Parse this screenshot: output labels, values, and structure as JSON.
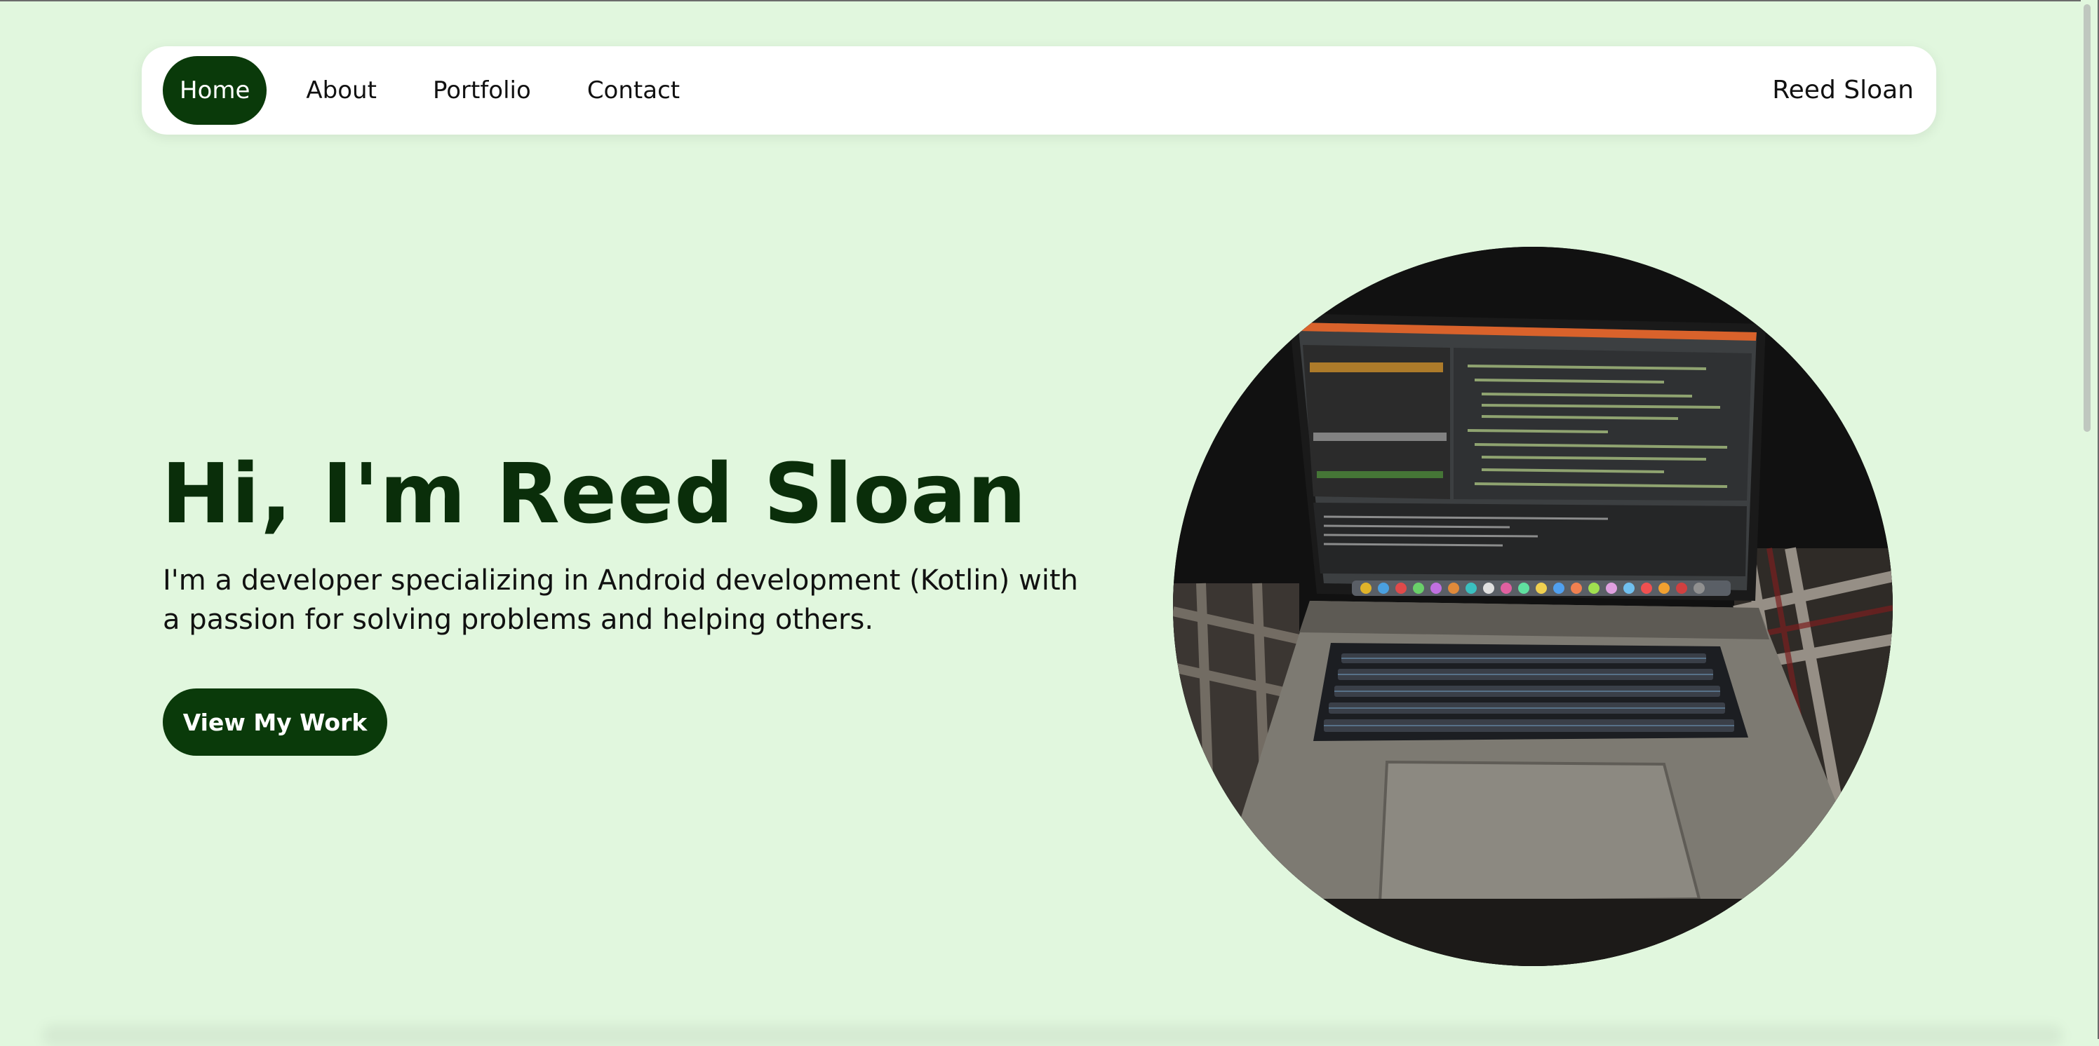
{
  "nav": {
    "links": [
      "Home",
      "About",
      "Portfolio",
      "Contact"
    ],
    "brand": "Reed Sloan",
    "active_index": 0
  },
  "hero": {
    "title": "Hi, I'm Reed Sloan",
    "subtitle": "I'm a developer specializing in Android development (Kotlin) with a passion for solving problems and helping others.",
    "cta_label": "View My Work"
  },
  "colors": {
    "background": "#e1f7de",
    "accent": "#0a3a0a",
    "title": "#0a2e0a"
  },
  "icons": {
    "hero_image": "laptop-photo"
  }
}
